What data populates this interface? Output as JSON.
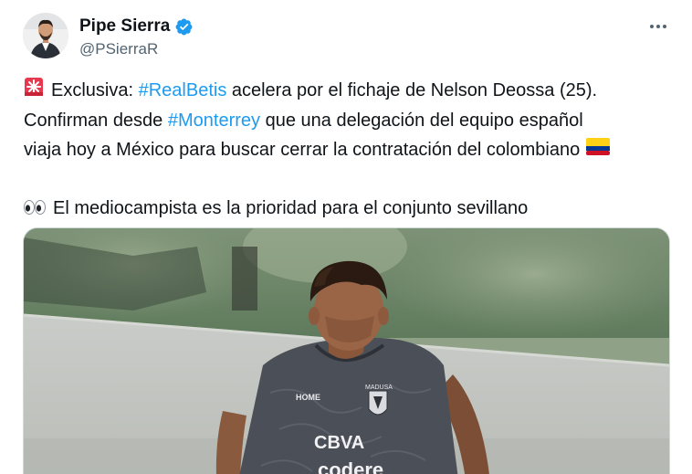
{
  "author": {
    "display_name": "Pipe Sierra",
    "handle": "@PSierraR",
    "verified": true
  },
  "icons": {
    "avatar": "profile-photo",
    "verified_badge": "verified-badge-icon",
    "more": "more-options-icon",
    "siren": "rotating-light-emoji",
    "eyes": "eyes-emoji",
    "flag": "colombia-flag-emoji"
  },
  "tweet": {
    "line1": {
      "before": "Exclusiva: ",
      "hashtag": "#RealBetis",
      "after": " acelera por el fichaje de Nelson Deossa (25)."
    },
    "line2": {
      "before": "Confirman desde ",
      "hashtag": "#Monterrey",
      "after": " que una delegación del equipo español"
    },
    "line3": {
      "text": "viaja hoy a México para buscar cerrar la contratación del colombiano"
    },
    "line4": {
      "text": "El mediocampista es la prioridad para el conjunto sevillano"
    }
  },
  "media": {
    "jersey_text_sponsor1": "CBVA",
    "jersey_text_sponsor2": "codere",
    "jersey_text_brand": "PUMA",
    "jersey_text_tag": "MADUSA",
    "jersey_text_sleeve": "HOME"
  },
  "colors": {
    "hashtag": "#1d9bf0",
    "verified": "#1d9bf0",
    "secondary_text": "#536471",
    "jersey": "#4b4f57"
  }
}
